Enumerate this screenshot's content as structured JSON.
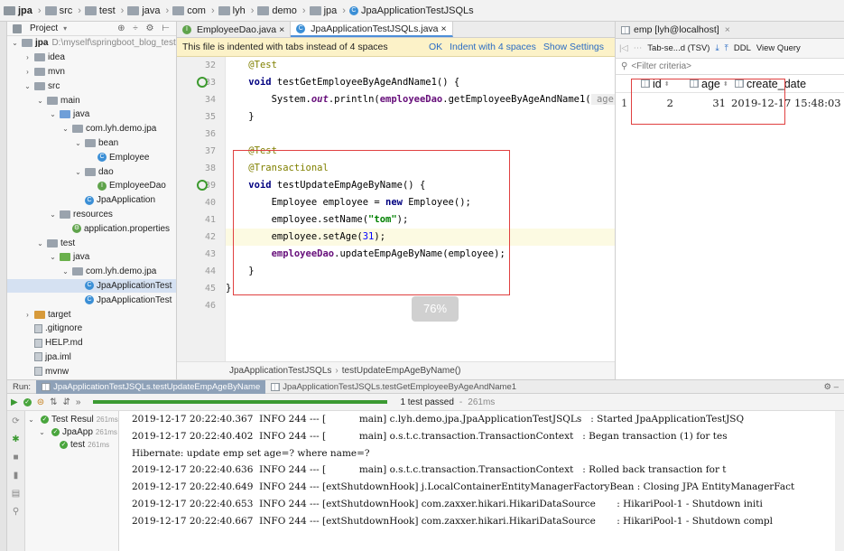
{
  "breadcrumb": [
    "jpa",
    "src",
    "test",
    "java",
    "com",
    "lyh",
    "demo",
    "jpa",
    "JpaApplicationTestJSQLs"
  ],
  "project": {
    "header": "Project",
    "root_name": "jpa",
    "root_path": "D:\\myself\\springboot_blog_test",
    "items": [
      {
        "depth": 1,
        "tri": "›",
        "icon": "folder",
        "label": "idea"
      },
      {
        "depth": 1,
        "tri": "›",
        "icon": "folder",
        "label": "mvn"
      },
      {
        "depth": 1,
        "tri": "⌄",
        "icon": "folder",
        "label": "src"
      },
      {
        "depth": 2,
        "tri": "⌄",
        "icon": "folder",
        "label": "main"
      },
      {
        "depth": 3,
        "tri": "⌄",
        "icon": "folder-blue",
        "label": "java"
      },
      {
        "depth": 4,
        "tri": "⌄",
        "icon": "folder",
        "label": "com.lyh.demo.jpa"
      },
      {
        "depth": 5,
        "tri": "⌄",
        "icon": "folder",
        "label": "bean"
      },
      {
        "depth": 6,
        "tri": "",
        "icon": "class",
        "label": "Employee"
      },
      {
        "depth": 5,
        "tri": "⌄",
        "icon": "folder",
        "label": "dao"
      },
      {
        "depth": 6,
        "tri": "",
        "icon": "interface",
        "label": "EmployeeDao"
      },
      {
        "depth": 5,
        "tri": "",
        "icon": "class",
        "label": "JpaApplication"
      },
      {
        "depth": 3,
        "tri": "⌄",
        "icon": "folder-res",
        "label": "resources"
      },
      {
        "depth": 4,
        "tri": "",
        "icon": "props",
        "label": "application.properties"
      },
      {
        "depth": 2,
        "tri": "⌄",
        "icon": "folder",
        "label": "test"
      },
      {
        "depth": 3,
        "tri": "⌄",
        "icon": "folder-green",
        "label": "java"
      },
      {
        "depth": 4,
        "tri": "⌄",
        "icon": "folder",
        "label": "com.lyh.demo.jpa"
      },
      {
        "depth": 5,
        "tri": "",
        "icon": "class",
        "label": "JpaApplicationTest",
        "selected": true
      },
      {
        "depth": 5,
        "tri": "",
        "icon": "class",
        "label": "JpaApplicationTest"
      },
      {
        "depth": 1,
        "tri": "›",
        "icon": "folder-orange",
        "label": "target"
      },
      {
        "depth": 1,
        "tri": "",
        "icon": "file",
        "label": ".gitignore"
      },
      {
        "depth": 1,
        "tri": "",
        "icon": "file",
        "label": "HELP.md"
      },
      {
        "depth": 1,
        "tri": "",
        "icon": "file",
        "label": "jpa.iml"
      },
      {
        "depth": 1,
        "tri": "",
        "icon": "file",
        "label": "mvnw"
      }
    ]
  },
  "editor": {
    "tabs": [
      {
        "label": "EmployeeDao.java",
        "icon": "interface",
        "active": false
      },
      {
        "label": "JpaApplicationTestJSQLs.java",
        "icon": "class",
        "active": true
      }
    ],
    "notice": "This file is indented with tabs instead of 4 spaces",
    "notice_links": [
      "OK",
      "Indent with 4 spaces",
      "Show Settings"
    ],
    "line_numbers": [
      "32",
      "33",
      "34",
      "35",
      "36",
      "37",
      "38",
      "39",
      "40",
      "41",
      "42",
      "43",
      "44",
      "45",
      "46"
    ],
    "breadcrumb": [
      "JpaApplicationTestJSQLs",
      "testUpdateEmpAgeByName()"
    ],
    "zoom": "76%",
    "code": {
      "l32_ann": "@Test",
      "l33_kw": "void",
      "l33_name": " testGetEmployeeByAgeAndName1() {",
      "l34_a": "System.",
      "l34_out": "out",
      "l34_b": ".println(",
      "l34_dao": "employeeDao",
      "l34_c": ".getEmployeeByAgeAndName1(",
      "l34_hint": " age:",
      "l35": "}",
      "l37_ann": "@Test",
      "l38_ann": "@Transactional",
      "l39_kw": "void",
      "l39_name": " testUpdateEmpAgeByName() {",
      "l40_a": "Employee employee = ",
      "l40_kw": "new",
      "l40_b": " Employee();",
      "l41_a": "employee.setName(",
      "l41_str": "\"tom\"",
      "l41_b": ");",
      "l42_a": "employee.setAge(",
      "l42_num": "31",
      "l42_b": ");",
      "l43_dao": "employeeDao",
      "l43_b": ".updateEmpAgeByName(employee);",
      "l44": "}",
      "l45": "}"
    }
  },
  "db": {
    "tab": "emp [lyh@localhost]",
    "toolbar": {
      "format": "Tab-se...d (TSV)",
      "ddl": "DDL",
      "view_query": "View Query"
    },
    "filter_placeholder": "<Filter criteria>",
    "columns": [
      "id",
      "age",
      "create_date"
    ],
    "rows": [
      {
        "num": "1",
        "id": "2",
        "age": "31",
        "create_date": "2019-12-17 15:48:03"
      }
    ]
  },
  "run": {
    "label": "Run:",
    "tabs": [
      "JpaApplicationTestJSQLs.testUpdateEmpAgeByName",
      "JpaApplicationTestJSQLs.testGetEmployeeByAgeAndName1"
    ],
    "status": "1 test passed",
    "status_time": "261ms",
    "progress": 1.0,
    "tree": [
      {
        "label": "Test Resul",
        "time": "261ms"
      },
      {
        "label": "JpaApp",
        "time": "261ms"
      },
      {
        "label": "test",
        "time": "261ms"
      }
    ],
    "log": [
      "2019-12-17 20:22:40.367  INFO 244 --- [           main] c.lyh.demo.jpa.JpaApplicationTestJSQLs   : Started JpaApplicationTestJSQ",
      "2019-12-17 20:22:40.402  INFO 244 --- [           main] o.s.t.c.transaction.TransactionContext   : Began transaction (1) for tes",
      "Hibernate: update emp set age=? where name=?",
      "2019-12-17 20:22:40.636  INFO 244 --- [           main] o.s.t.c.transaction.TransactionContext   : Rolled back transaction for t",
      "2019-12-17 20:22:40.649  INFO 244 --- [extShutdownHook] j.LocalContainerEntityManagerFactoryBean : Closing JPA EntityManagerFact",
      "2019-12-17 20:22:40.653  INFO 244 --- [extShutdownHook] com.zaxxer.hikari.HikariDataSource       : HikariPool-1 - Shutdown initi",
      "2019-12-17 20:22:40.667  INFO 244 --- [extShutdownHook] com.zaxxer.hikari.HikariDataSource       : HikariPool-1 - Shutdown compl"
    ]
  }
}
